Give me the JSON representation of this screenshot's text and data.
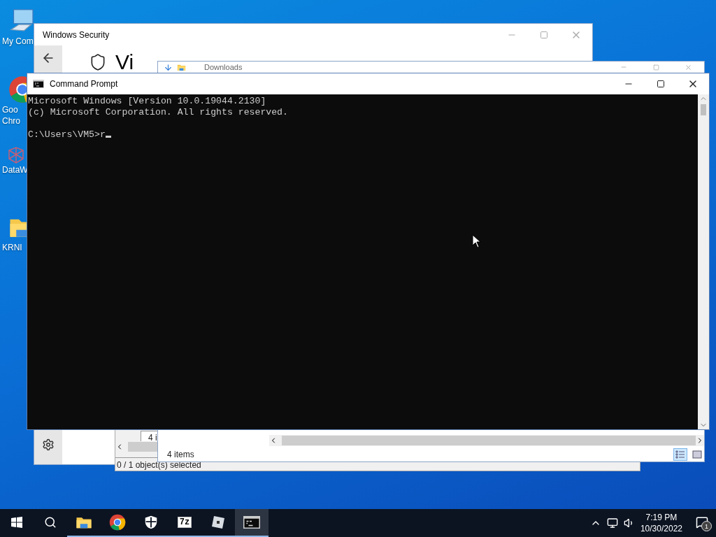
{
  "desktop": {
    "icons": [
      {
        "kind": "computer",
        "lines": [
          "My Com"
        ]
      },
      {
        "kind": "chrome",
        "lines": [
          "Goo",
          "Chro"
        ]
      },
      {
        "kind": "molecule",
        "lines": [
          "DataW"
        ]
      },
      {
        "kind": "folder",
        "lines": [
          "KRNI"
        ]
      }
    ]
  },
  "security_window": {
    "title": "Windows Security",
    "heading": "Vi"
  },
  "archive_window": {
    "tooltip": "4 i",
    "status": "0 / 1 object(s) selected"
  },
  "explorer_window": {
    "title": "Downloads",
    "status": "4 items",
    "views": [
      {
        "kind": "details",
        "selected": true
      },
      {
        "kind": "tiles",
        "selected": false
      }
    ]
  },
  "console_window": {
    "title": "Command Prompt",
    "lines": [
      "Microsoft Windows [Version 10.0.19044.2130]",
      "(c) Microsoft Corporation. All rights reserved."
    ],
    "prompt": "C:\\Users\\VM5>r",
    "cursor": true
  },
  "taskbar": {
    "apps": [
      {
        "kind": "folder",
        "running": true,
        "selected": false
      },
      {
        "kind": "chrome",
        "running": true,
        "selected": false
      },
      {
        "kind": "shield",
        "running": true,
        "selected": false
      },
      {
        "kind": "archiver",
        "glyph": "7z",
        "running": true,
        "selected": false
      },
      {
        "kind": "cube",
        "running": true,
        "selected": false
      },
      {
        "kind": "console",
        "running": true,
        "selected": true
      }
    ],
    "time": "7:19 PM",
    "date": "10/30/2022",
    "notifications": "1"
  }
}
